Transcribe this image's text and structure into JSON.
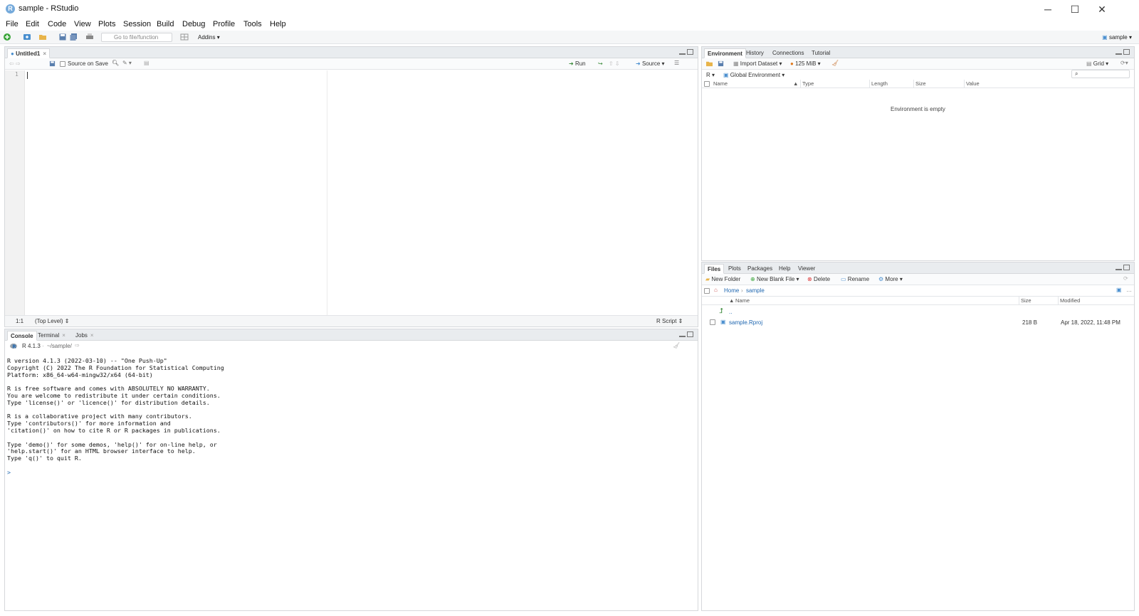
{
  "window": {
    "title": "sample - RStudio",
    "logo_letter": "R",
    "controls": {
      "minimize": "─",
      "maximize": "☐",
      "close": "✕"
    }
  },
  "menu": [
    "File",
    "Edit",
    "Code",
    "View",
    "Plots",
    "Session",
    "Build",
    "Debug",
    "Profile",
    "Tools",
    "Help"
  ],
  "main_toolbar": {
    "goto_placeholder": "Go to file/function",
    "addins_label": "Addins",
    "project_label": "sample"
  },
  "editor": {
    "tab_label": "Untitled1",
    "source_on_save": "Source on Save",
    "run_label": "Run",
    "source_label": "Source",
    "line_number": "1",
    "cursor_position": "1:1",
    "scope": "(Top Level)",
    "file_type": "R Script"
  },
  "console": {
    "tabs": [
      "Console",
      "Terminal",
      "Jobs"
    ],
    "r_version": "R 4.1.3",
    "path": "~/sample/",
    "output": [
      "R version 4.1.3 (2022-03-10) -- \"One Push-Up\"",
      "Copyright (C) 2022 The R Foundation for Statistical Computing",
      "Platform: x86_64-w64-mingw32/x64 (64-bit)",
      "",
      "R is free software and comes with ABSOLUTELY NO WARRANTY.",
      "You are welcome to redistribute it under certain conditions.",
      "Type 'license()' or 'licence()' for distribution details.",
      "",
      "R is a collaborative project with many contributors.",
      "Type 'contributors()' for more information and",
      "'citation()' on how to cite R or R packages in publications.",
      "",
      "Type 'demo()' for some demos, 'help()' for on-line help, or",
      "'help.start()' for an HTML browser interface to help.",
      "Type 'q()' to quit R.",
      "",
      "> "
    ]
  },
  "environment": {
    "tabs": [
      "Environment",
      "History",
      "Connections",
      "Tutorial"
    ],
    "import_dataset": "Import Dataset",
    "memory": "125 MiB",
    "view_mode": "Grid",
    "language": "R",
    "scope": "Global Environment",
    "columns": [
      "Name",
      "Type",
      "Length",
      "Size",
      "Value"
    ],
    "empty_message": "Environment is empty"
  },
  "files": {
    "tabs": [
      "Files",
      "Plots",
      "Packages",
      "Help",
      "Viewer"
    ],
    "new_folder": "New Folder",
    "new_blank_file": "New Blank File",
    "delete": "Delete",
    "rename": "Rename",
    "more": "More",
    "breadcrumb": [
      "Home",
      "sample"
    ],
    "columns": [
      "Name",
      "Size",
      "Modified"
    ],
    "parent_dir": "..",
    "rows": [
      {
        "name": "sample.Rproj",
        "size": "218 B",
        "modified": "Apr 18, 2022, 11:48 PM"
      }
    ]
  }
}
